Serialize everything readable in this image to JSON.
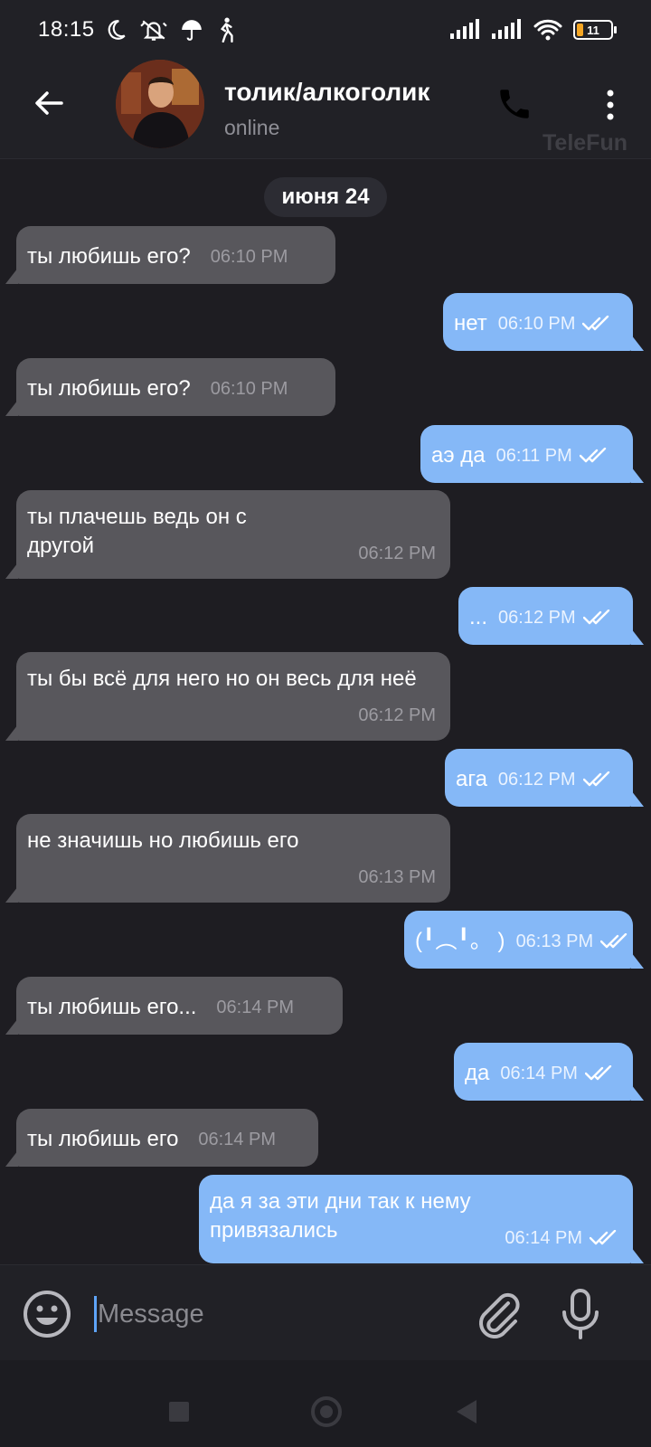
{
  "status_bar": {
    "time": "18:15",
    "battery": "11",
    "icons_left": [
      "moon-icon",
      "bell-off-icon",
      "umbrella-icon",
      "walking-icon"
    ],
    "icons_right": [
      "signal-icon",
      "signal-icon",
      "wifi-icon",
      "battery-icon"
    ]
  },
  "header": {
    "title": "толик/алкоголик",
    "status": "online",
    "watermark": "TeleFun"
  },
  "date_separator": "июня 24",
  "messages": [
    {
      "dir": "in",
      "text": "ты любишь его?",
      "time": "06:10 PM"
    },
    {
      "dir": "out",
      "text": "нет",
      "time": "06:10 PM",
      "read": true
    },
    {
      "dir": "in",
      "text": "ты любишь его?",
      "time": "06:10 PM"
    },
    {
      "dir": "out",
      "text": "аэ да",
      "time": "06:11 PM",
      "read": true
    },
    {
      "dir": "in",
      "text": "ты плачешь ведь он с другой",
      "time": "06:12 PM"
    },
    {
      "dir": "out",
      "text": "...",
      "time": "06:12 PM",
      "read": true
    },
    {
      "dir": "in",
      "text": "ты бы всё для него но он весь для неё",
      "time": "06:12 PM"
    },
    {
      "dir": "out",
      "text": "ага",
      "time": "06:12 PM",
      "read": true
    },
    {
      "dir": "in",
      "text": "не значишь но любишь его",
      "time": "06:13 PM"
    },
    {
      "dir": "out",
      "text": "(╹︵╹。 )",
      "time": "06:13 PM",
      "read": true
    },
    {
      "dir": "in",
      "text": "ты любишь его...",
      "time": "06:14 PM"
    },
    {
      "dir": "out",
      "text": "да",
      "time": "06:14 PM",
      "read": true
    },
    {
      "dir": "in",
      "text": "ты любишь его",
      "time": "06:14 PM"
    },
    {
      "dir": "out",
      "text": "да я за эти дни так к нему привязались",
      "time": "06:14 PM",
      "read": true
    }
  ],
  "input": {
    "placeholder": "Message",
    "value": ""
  },
  "colors": {
    "background": "#1e1d22",
    "incoming_bubble": "#58575c",
    "outgoing_bubble": "#85b8f7",
    "accent": "#5ea4f7"
  }
}
